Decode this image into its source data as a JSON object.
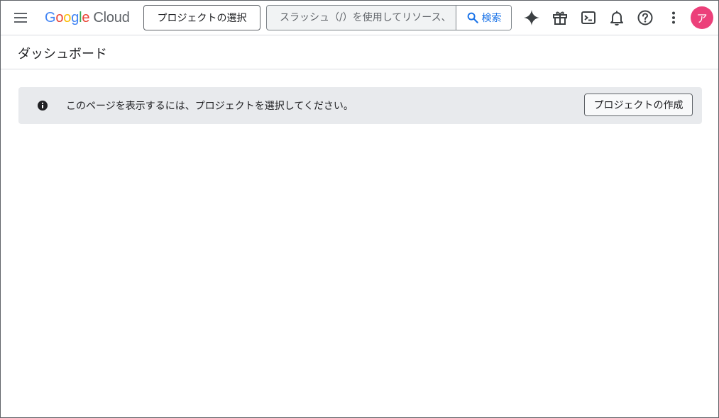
{
  "header": {
    "menu_icon": "menu-icon",
    "logo": {
      "letters": [
        "G",
        "o",
        "o",
        "g",
        "l",
        "e"
      ],
      "product": "Cloud",
      "colors": {
        "blue": "#4285f4",
        "red": "#ea4335",
        "yellow": "#fbbc04",
        "green": "#34a853",
        "grey": "#5f6368"
      }
    },
    "project_selector_label": "プロジェクトの選択",
    "search": {
      "placeholder": "スラッシュ（/）を使用してリソース、ドキュメント、プロダクトなどを検索",
      "value": "",
      "button_label": "検索",
      "icon": "search-icon"
    },
    "icons": [
      "gemini-sparkle-icon",
      "gift-icon",
      "cloud-shell-icon",
      "notifications-bell-icon",
      "help-icon",
      "more-vert-icon"
    ],
    "avatar": {
      "initial": "ア",
      "color": "#ec407a"
    }
  },
  "page": {
    "title": "ダッシュボード"
  },
  "banner": {
    "icon": "info-icon",
    "message": "このページを表示するには、プロジェクトを選択してください。",
    "action_label": "プロジェクトの作成"
  }
}
